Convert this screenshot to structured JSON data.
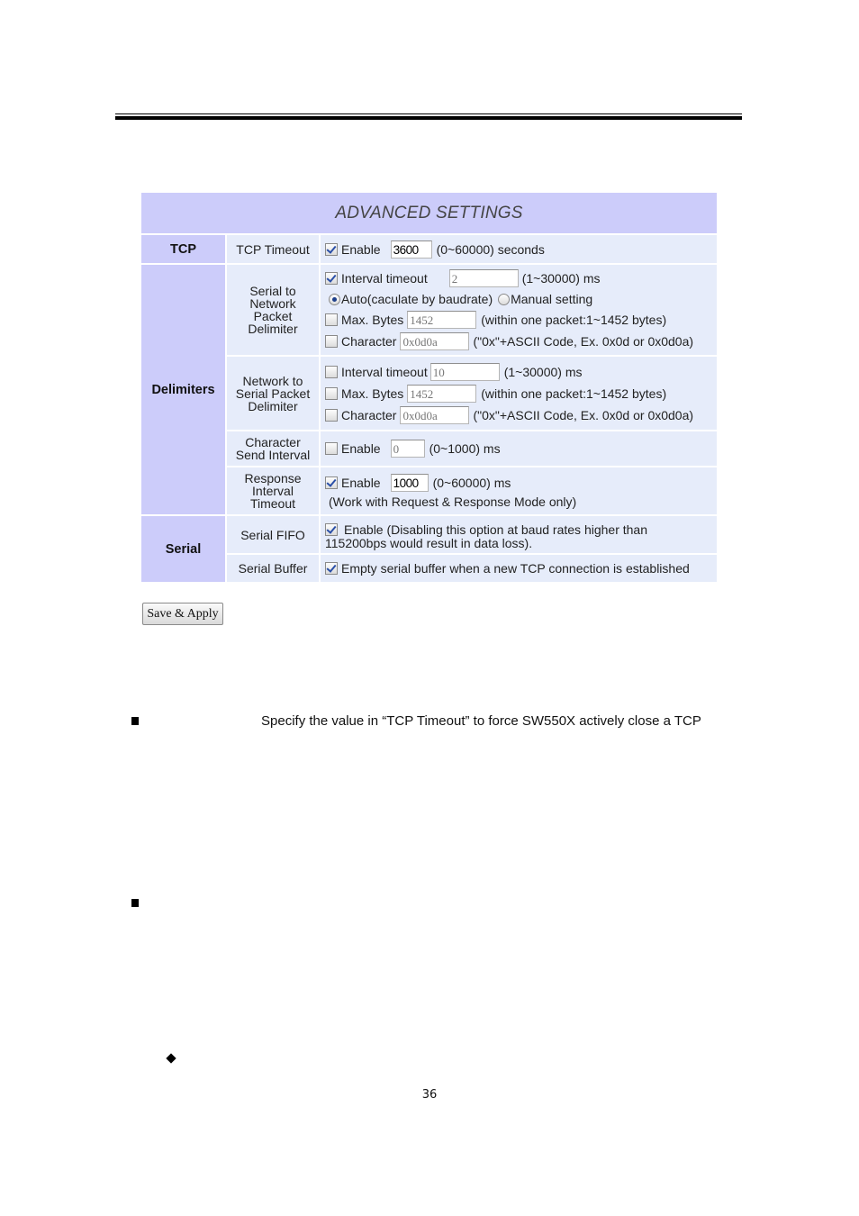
{
  "panel": {
    "title": "ADVANCED SETTINGS",
    "colors": {
      "header_bg": "#ccccfa",
      "cell_bg": "#e6ecfa"
    },
    "tcp": {
      "section_label": "TCP",
      "timeout": {
        "label": "TCP Timeout",
        "enable_checked": true,
        "enable_label": "Enable",
        "value": "3600",
        "range": "(0~60000) seconds"
      }
    },
    "delimiters": {
      "section_label": "Delimiters",
      "serial_to_network": {
        "label_lines": [
          "Serial to",
          "Network",
          "Packet",
          "Delimiter"
        ],
        "interval_timeout": {
          "checked": true,
          "label": "Interval timeout",
          "value": "2",
          "range": "(1~30000) ms"
        },
        "mode": {
          "auto_label": "Auto(caculate by baudrate)",
          "manual_label": "Manual setting",
          "selected": "auto"
        },
        "max_bytes": {
          "checked": false,
          "label": "Max. Bytes",
          "value": "1452",
          "hint": "(within one packet:1~1452 bytes)"
        },
        "character": {
          "checked": false,
          "label": "Character",
          "value": "0x0d0a",
          "hint": "(\"0x\"+ASCII Code, Ex. 0x0d or 0x0d0a)"
        }
      },
      "network_to_serial": {
        "label_lines": [
          "Network to",
          "Serial Packet",
          "Delimiter"
        ],
        "interval_timeout": {
          "checked": false,
          "label": "Interval timeout",
          "value": "10",
          "range": "(1~30000) ms"
        },
        "max_bytes": {
          "checked": false,
          "label": "Max. Bytes",
          "value": "1452",
          "hint": "(within one packet:1~1452 bytes)"
        },
        "character": {
          "checked": false,
          "label": "Character",
          "value": "0x0d0a",
          "hint": "(\"0x\"+ASCII Code, Ex. 0x0d or 0x0d0a)"
        }
      },
      "char_send_interval": {
        "label_lines": [
          "Character",
          "Send Interval"
        ],
        "checked": false,
        "enable_label": "Enable",
        "value": "0",
        "range": "(0~1000) ms"
      },
      "response_interval": {
        "label_lines": [
          "Response",
          "Interval",
          "Timeout"
        ],
        "checked": true,
        "enable_label": "Enable",
        "value": "1000",
        "range": "(0~60000) ms",
        "note": "(Work with Request & Response Mode only)"
      }
    },
    "serial": {
      "section_label": "Serial",
      "fifo": {
        "label": "Serial FIFO",
        "checked": true,
        "text_line1": "Enable (Disabling this option at baud rates higher than",
        "text_line2": "115200bps would result in data loss)."
      },
      "buffer": {
        "label": "Serial Buffer",
        "checked": true,
        "text": "Empty serial buffer when a new TCP connection is established"
      }
    }
  },
  "save_button": "Save & Apply",
  "body_text": {
    "paragraph1": "Specify the value in “TCP Timeout” to force SW550X actively close a TCP"
  },
  "page_number": "36"
}
